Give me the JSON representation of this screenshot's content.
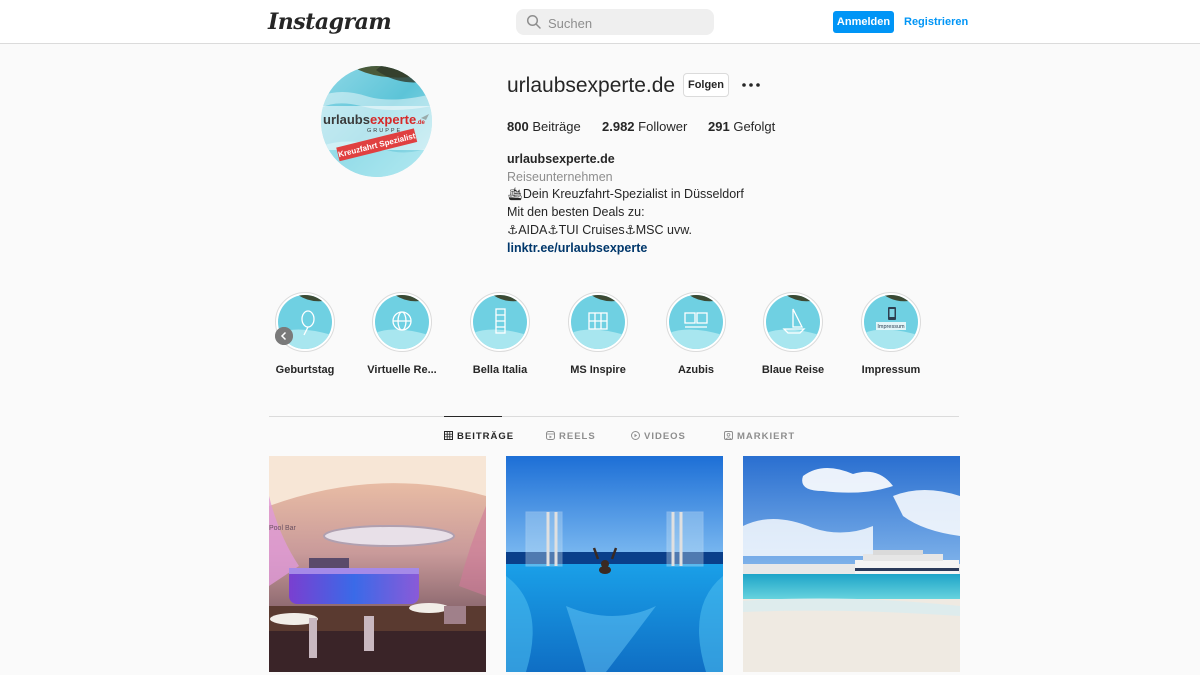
{
  "header": {
    "logo_text": "Instagram",
    "search_placeholder": "Suchen",
    "login_label": "Anmelden",
    "register_label": "Registrieren"
  },
  "profile": {
    "username": "urlaubsexperte.de",
    "follow_label": "Folgen",
    "avatar_text": {
      "brand_part1": "urlaubs",
      "brand_part2": "experte",
      "brand_suffix": ".de",
      "group": "GRUPPE",
      "ribbon": "Kreuzfahrt Spezialist"
    },
    "stats": [
      {
        "count": "800",
        "label": "Beiträge"
      },
      {
        "count": "2.982",
        "label": "Follower"
      },
      {
        "count": "291",
        "label": "Gefolgt"
      }
    ],
    "bio": {
      "name": "urlaubsexperte.de",
      "category": "Reiseunternehmen",
      "line1": "🛳Dein Kreuzfahrt-Spezialist in Düsseldorf",
      "line2": "Mit den besten Deals zu:",
      "line3": "⚓AIDA⚓TUI Cruises⚓MSC uvw.",
      "link": "linktr.ee/urlaubsexperte"
    }
  },
  "highlights": [
    {
      "label": "Geburtstag",
      "icon": "balloon-icon"
    },
    {
      "label": "Virtuelle Re...",
      "icon": "globe-icon"
    },
    {
      "label": "Bella Italia",
      "icon": "tower-icon"
    },
    {
      "label": "MS Inspire",
      "icon": "ship-icon"
    },
    {
      "label": "Azubis",
      "icon": "people-icon"
    },
    {
      "label": "Blaue Reise",
      "icon": "sailboat-icon"
    },
    {
      "label": "Impressum",
      "icon": "phone-icon",
      "badge": "Impressum"
    }
  ],
  "tabs": [
    {
      "label": "BEITRÄGE",
      "icon": "grid-icon",
      "active": true
    },
    {
      "label": "REELS",
      "icon": "reels-icon",
      "active": false
    },
    {
      "label": "VIDEOS",
      "icon": "play-icon",
      "active": false
    },
    {
      "label": "MARKIERT",
      "icon": "tag-icon",
      "active": false
    }
  ],
  "posts": [
    {
      "subject": "ship-bar-interior",
      "sign_text": "Pool Bar"
    },
    {
      "subject": "infinity-pool-sea"
    },
    {
      "subject": "cruise-ship-beach"
    }
  ],
  "colors": {
    "accent": "#0095f6",
    "link": "#00376b",
    "muted": "#8e8e8e",
    "border": "#dbdbdb",
    "background": "#fafafa"
  }
}
